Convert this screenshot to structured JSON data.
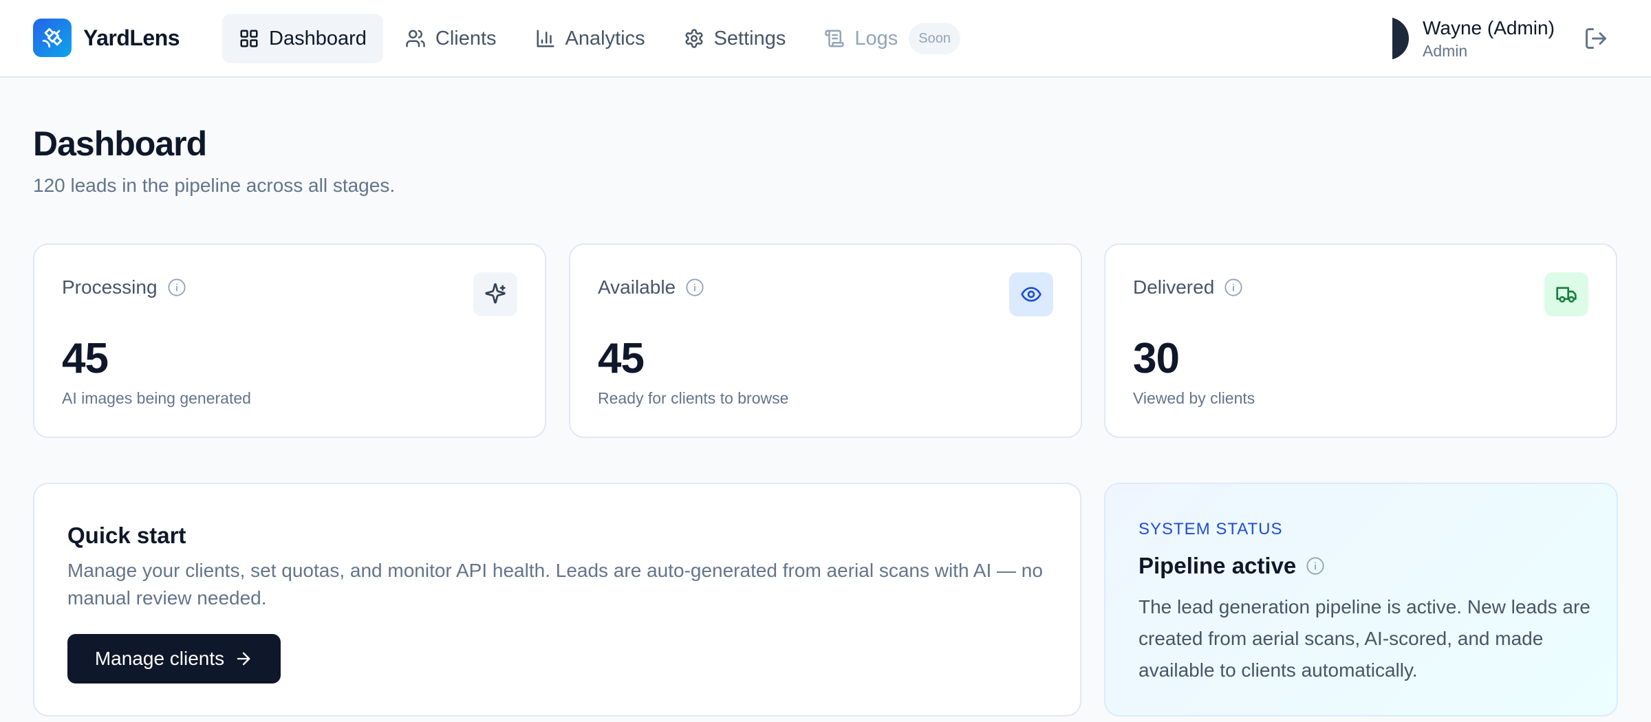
{
  "app": {
    "name": "YardLens"
  },
  "nav": {
    "items": [
      {
        "label": "Dashboard",
        "icon": "dashboard-grid-icon",
        "active": true
      },
      {
        "label": "Clients",
        "icon": "users-icon",
        "active": false
      },
      {
        "label": "Analytics",
        "icon": "bar-chart-icon",
        "active": false
      },
      {
        "label": "Settings",
        "icon": "gear-icon",
        "active": false
      },
      {
        "label": "Logs",
        "icon": "scroll-icon",
        "active": false,
        "disabled": true,
        "badge": "Soon"
      }
    ]
  },
  "user": {
    "name": "Wayne (Admin)",
    "role": "Admin"
  },
  "page": {
    "title": "Dashboard",
    "subtitle": "120 leads in the pipeline across all stages."
  },
  "stats": [
    {
      "label": "Processing",
      "value": "45",
      "caption": "AI images being generated",
      "icon": "sparkles-icon",
      "icon_bg": "#f1f5f9",
      "icon_color": "#334155"
    },
    {
      "label": "Available",
      "value": "45",
      "caption": "Ready for clients to browse",
      "icon": "eye-icon",
      "icon_bg": "#dbeafe",
      "icon_color": "#1d4ed8"
    },
    {
      "label": "Delivered",
      "value": "30",
      "caption": "Viewed by clients",
      "icon": "truck-icon",
      "icon_bg": "#dcfce7",
      "icon_color": "#15803d"
    }
  ],
  "quick_start": {
    "title": "Quick start",
    "text": "Manage your clients, set quotas, and monitor API health. Leads are auto-generated from aerial scans with AI — no manual review needed.",
    "button_label": "Manage clients"
  },
  "system_status": {
    "eyebrow": "SYSTEM STATUS",
    "title": "Pipeline active",
    "text": "The lead generation pipeline is active. New leads are created from aerial scans, AI-scored, and made available to clients automatically."
  },
  "colors": {
    "brand_gradient_start": "#2563eb",
    "brand_gradient_end": "#0ea5e9",
    "primary_button": "#0f172a",
    "status_accent": "#1d4ed8"
  }
}
